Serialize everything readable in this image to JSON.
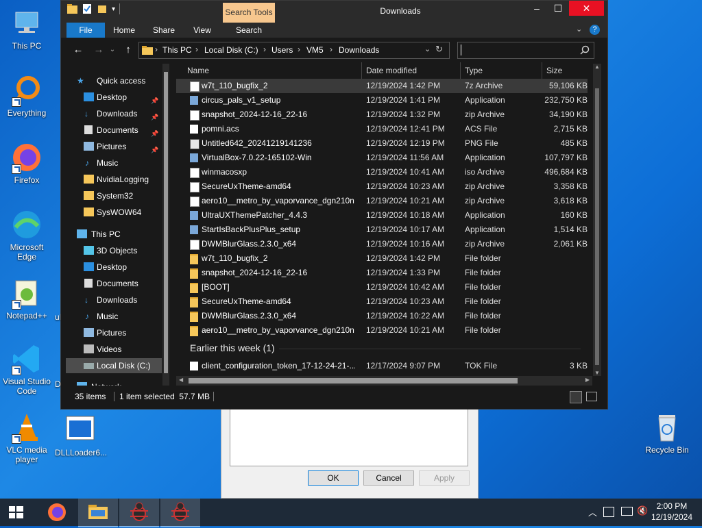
{
  "desktop": {
    "icons": [
      {
        "label": "This PC"
      },
      {
        "label": "Everything"
      },
      {
        "label": "Firefox"
      },
      {
        "label": "Microsoft Edge"
      },
      {
        "label": "Notepad++"
      },
      {
        "label": "Visual Studio Code"
      },
      {
        "label": "VLC media player"
      },
      {
        "label": "DLLLoader6..."
      },
      {
        "label": "Recycle Bin"
      }
    ],
    "partial_labels": {
      "ud": "uD",
      "dl": "DL"
    }
  },
  "bg_dialog": {
    "ok": "OK",
    "cancel": "Cancel",
    "apply": "Apply"
  },
  "explorer": {
    "title": "Downloads",
    "search_tools": "Search Tools",
    "ribbon_tabs": [
      "File",
      "Home",
      "Share",
      "View",
      "Search"
    ],
    "address": {
      "segments": [
        "This PC",
        "Local Disk (C:)",
        "Users",
        "VM5",
        "Downloads"
      ]
    },
    "search": {
      "placeholder": ""
    },
    "nav": {
      "items": [
        {
          "label": "Quick access"
        },
        {
          "label": "Desktop"
        },
        {
          "label": "Downloads"
        },
        {
          "label": "Documents"
        },
        {
          "label": "Pictures"
        },
        {
          "label": "Music"
        },
        {
          "label": "NvidiaLogging"
        },
        {
          "label": "System32"
        },
        {
          "label": "SysWOW64"
        },
        {
          "label": "This PC"
        },
        {
          "label": "3D Objects"
        },
        {
          "label": "Desktop"
        },
        {
          "label": "Documents"
        },
        {
          "label": "Downloads"
        },
        {
          "label": "Music"
        },
        {
          "label": "Pictures"
        },
        {
          "label": "Videos"
        },
        {
          "label": "Local Disk (C:)"
        },
        {
          "label": "Network"
        }
      ]
    },
    "columns": {
      "name": "Name",
      "date": "Date modified",
      "type": "Type",
      "size": "Size"
    },
    "files": [
      {
        "name": "w7t_110_bugfix_2",
        "date": "12/19/2024 1:42 PM",
        "type": "7z Archive",
        "size": "59,106 KB"
      },
      {
        "name": "circus_pals_v1_setup",
        "date": "12/19/2024 1:41 PM",
        "type": "Application",
        "size": "232,750 KB"
      },
      {
        "name": "snapshot_2024-12-16_22-16",
        "date": "12/19/2024 1:32 PM",
        "type": "zip Archive",
        "size": "34,190 KB"
      },
      {
        "name": "pomni.acs",
        "date": "12/19/2024 12:41 PM",
        "type": "ACS File",
        "size": "2,715 KB"
      },
      {
        "name": "Untitled642_20241219141236",
        "date": "12/19/2024 12:19 PM",
        "type": "PNG File",
        "size": "485 KB"
      },
      {
        "name": "VirtualBox-7.0.22-165102-Win",
        "date": "12/19/2024 11:56 AM",
        "type": "Application",
        "size": "107,797 KB"
      },
      {
        "name": "winmacosxp",
        "date": "12/19/2024 10:41 AM",
        "type": "iso Archive",
        "size": "496,684 KB"
      },
      {
        "name": "SecureUxTheme-amd64",
        "date": "12/19/2024 10:23 AM",
        "type": "zip Archive",
        "size": "3,358 KB"
      },
      {
        "name": "aero10__metro_by_vaporvance_dgn210n",
        "date": "12/19/2024 10:21 AM",
        "type": "zip Archive",
        "size": "3,618 KB"
      },
      {
        "name": "UltraUXThemePatcher_4.4.3",
        "date": "12/19/2024 10:18 AM",
        "type": "Application",
        "size": "160 KB"
      },
      {
        "name": "StartIsBackPlusPlus_setup",
        "date": "12/19/2024 10:17 AM",
        "type": "Application",
        "size": "1,514 KB"
      },
      {
        "name": "DWMBlurGlass.2.3.0_x64",
        "date": "12/19/2024 10:16 AM",
        "type": "zip Archive",
        "size": "2,061 KB"
      },
      {
        "name": "w7t_110_bugfix_2",
        "date": "12/19/2024 1:42 PM",
        "type": "File folder",
        "size": ""
      },
      {
        "name": "snapshot_2024-12-16_22-16",
        "date": "12/19/2024 1:33 PM",
        "type": "File folder",
        "size": ""
      },
      {
        "name": "[BOOT]",
        "date": "12/19/2024 10:42 AM",
        "type": "File folder",
        "size": ""
      },
      {
        "name": "SecureUxTheme-amd64",
        "date": "12/19/2024 10:23 AM",
        "type": "File folder",
        "size": ""
      },
      {
        "name": "DWMBlurGlass.2.3.0_x64",
        "date": "12/19/2024 10:22 AM",
        "type": "File folder",
        "size": ""
      },
      {
        "name": "aero10__metro_by_vaporvance_dgn210n",
        "date": "12/19/2024 10:21 AM",
        "type": "File folder",
        "size": ""
      }
    ],
    "group_earlier": "Earlier this week (1)",
    "earlier_files": [
      {
        "name": "client_configuration_token_17-12-24-21-...",
        "date": "12/17/2024 9:07 PM",
        "type": "TOK File",
        "size": "3 KB"
      }
    ],
    "status": {
      "count": "35 items",
      "selected": "1 item selected  57.7 MB"
    }
  },
  "taskbar": {
    "time": "2:00 PM",
    "date": "12/19/2024"
  }
}
